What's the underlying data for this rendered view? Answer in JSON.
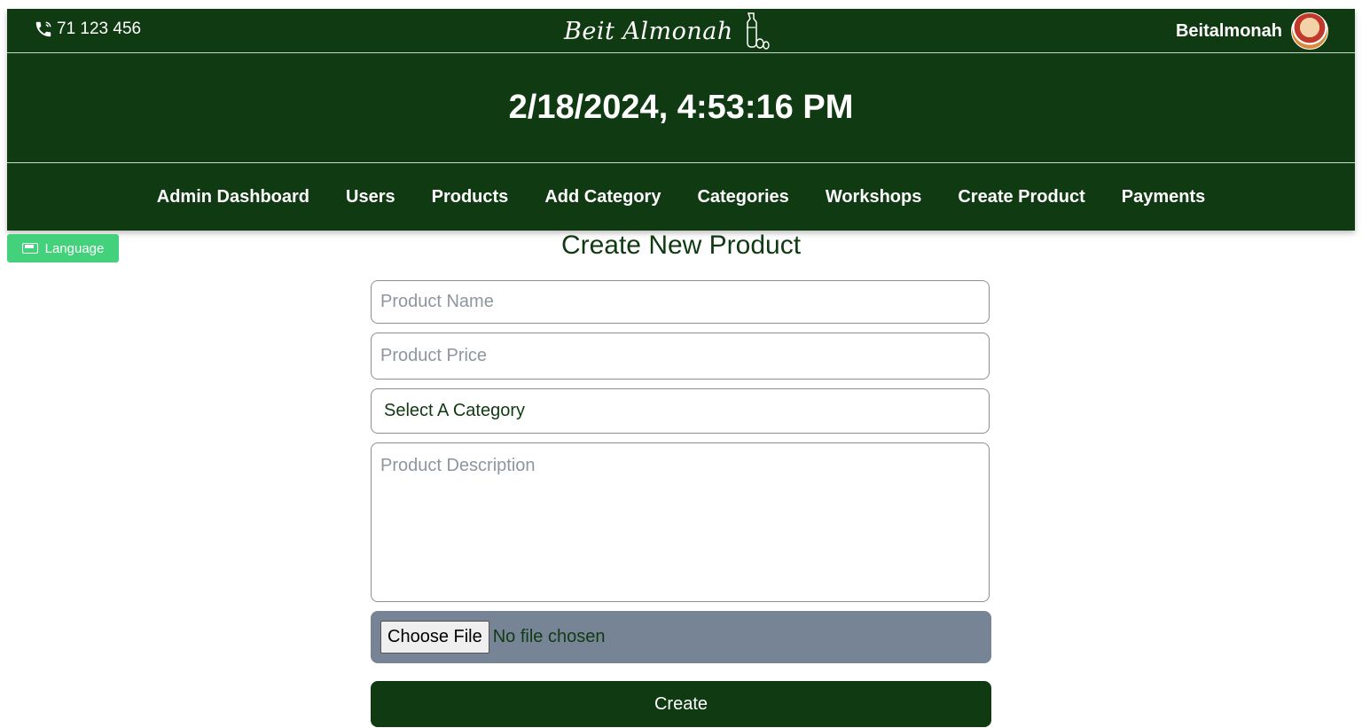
{
  "header": {
    "phone": "71 123 456",
    "logo_text": "Beit Almonah",
    "username": "Beitalmonah",
    "datetime": "2/18/2024, 4:53:16 PM"
  },
  "nav": {
    "items": [
      {
        "label": "Admin Dashboard"
      },
      {
        "label": "Users"
      },
      {
        "label": "Products"
      },
      {
        "label": "Add Category"
      },
      {
        "label": "Categories"
      },
      {
        "label": "Workshops"
      },
      {
        "label": "Create Product"
      },
      {
        "label": "Payments"
      }
    ]
  },
  "language_button": {
    "label": "Language"
  },
  "form": {
    "title": "Create New Product",
    "name_placeholder": "Product Name",
    "price_placeholder": "Product Price",
    "category_selected": "Select A Category",
    "description_placeholder": "Product Description",
    "file_button": "Choose File",
    "file_status": "No file chosen",
    "submit_label": "Create"
  },
  "colors": {
    "brand_green": "#103a12",
    "language_green": "#43d17b",
    "file_area": "#768496"
  }
}
